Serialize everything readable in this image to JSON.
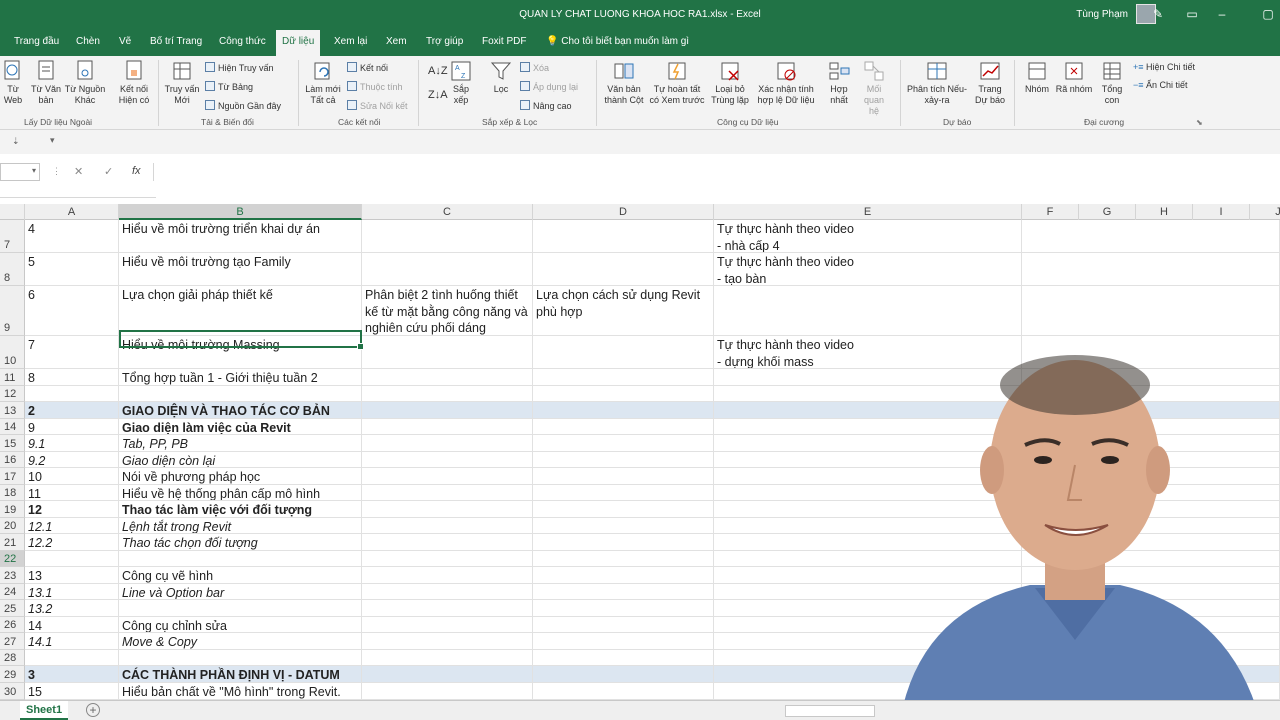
{
  "window": {
    "title": "QUAN LY CHAT LUONG KHOA HOC RA1.xlsx  -  Excel",
    "user": "Tùng Phạm"
  },
  "tabs": [
    "Trang đầu",
    "Chèn",
    "Vẽ",
    "Bố trí Trang",
    "Công thức",
    "Dữ liệu",
    "Xem lại",
    "Xem",
    "Trợ giúp",
    "Foxit PDF"
  ],
  "tell_me": "Cho tôi biết bạn muốn làm gì",
  "ribbon": {
    "get_external": {
      "label": "Lấy Dữ liệu Ngoài",
      "web": "Từ\nWeb",
      "text": "Từ Văn\nbản",
      "other": "Từ Nguồn\nKhác",
      "existing": "Kết nối\nHiện có"
    },
    "transform": {
      "label": "Tải & Biến đổi",
      "new_query": "Truy vấn\nMới",
      "show_queries": "Hiện Truy vấn",
      "from_table": "Từ Bảng",
      "recent_sources": "Nguồn Gần đây"
    },
    "connections": {
      "label": "Các kết nối",
      "refresh_all": "Làm mới\nTất cả",
      "connections": "Kết nối",
      "properties": "Thuộc tính",
      "edit_links": "Sửa Nối kết"
    },
    "sort_filter": {
      "label": "Sắp xếp & Lọc",
      "sort": "Sắp\nxếp",
      "filter": "Lọc",
      "clear": "Xóa",
      "reapply": "Áp dụng lại",
      "advanced": "Nâng cao"
    },
    "data_tools": {
      "label": "Công cụ Dữ liệu",
      "text_to_columns": "Văn bản\nthành Cột",
      "flash_fill": "Tự hoàn tất\ncó Xem trước",
      "remove_duplicates": "Loại bỏ\nTrùng lặp",
      "data_validation": "Xác nhận tính\nhợp lệ Dữ liệu",
      "consolidate": "Hợp\nnhất",
      "relationships": "Mối\nquan hệ"
    },
    "forecast": {
      "label": "Dự báo",
      "what_if": "Phân tích Nếu-\nxảy-ra",
      "forecast_sheet": "Trang\nDự báo"
    },
    "outline": {
      "label": "Đại cương",
      "group": "Nhóm",
      "ungroup": "Rã nhóm",
      "subtotal": "Tổng\ncon",
      "show_detail": "Hiện Chi tiết",
      "hide_detail": "Ẩn Chi tiết"
    }
  },
  "formula_bar": {
    "fx": "fx",
    "cancel": "✕",
    "enter": "✓"
  },
  "columns": [
    "A",
    "B",
    "C",
    "D",
    "E",
    "F",
    "G",
    "H",
    "I",
    "J"
  ],
  "selected_column": "B",
  "rows": [
    {
      "num": "7",
      "a": "4",
      "b": "Hiểu về môi trường triển khai dự án",
      "c": "",
      "d": "",
      "e": "Tự thực hành theo video\n- nhà cấp 4"
    },
    {
      "num": "8",
      "a": "5",
      "b": "Hiểu về môi trường tạo Family",
      "c": "",
      "d": "",
      "e": "Tự thực hành theo video\n- tạo bàn"
    },
    {
      "num": "9",
      "a": "6",
      "b": "Lựa chọn giải pháp thiết kế",
      "c": "Phân biệt 2 tình huống thiết kế từ mặt bằng công năng và nghiên cứu phối dáng",
      "d": "Lựa chọn cách sử dụng Revit phù hợp",
      "e": ""
    },
    {
      "num": "10",
      "a": "7",
      "b": "Hiểu về môi trường Massing",
      "c": "",
      "d": "",
      "e": "Tự thực hành theo video\n- dựng khối mass"
    },
    {
      "num": "11",
      "a": "8",
      "b": "Tổng hợp tuần 1 - Giới thiệu tuần 2",
      "c": "",
      "d": "",
      "e": ""
    },
    {
      "num": "12",
      "a": "",
      "b": "",
      "c": "",
      "d": "",
      "e": ""
    },
    {
      "num": "13",
      "a": "2",
      "b": "GIAO DIỆN VÀ THAO TÁC CƠ BẢN",
      "c": "",
      "d": "",
      "e": ""
    },
    {
      "num": "14",
      "a": "9",
      "b": "Giao diện làm việc của Revit",
      "c": "",
      "d": "",
      "e": ""
    },
    {
      "num": "15",
      "a": "9.1",
      "b": "Tab, PP, PB",
      "c": "",
      "d": "",
      "e": ""
    },
    {
      "num": "16",
      "a": "9.2",
      "b": "Giao diện còn lại",
      "c": "",
      "d": "",
      "e": ""
    },
    {
      "num": "17",
      "a": "10",
      "b": "Nói về phương pháp học",
      "c": "",
      "d": "",
      "e": ""
    },
    {
      "num": "18",
      "a": "11",
      "b": "Hiểu về hệ thống phân cấp mô hình",
      "c": "",
      "d": "",
      "e": ""
    },
    {
      "num": "19",
      "a": "12",
      "b": "Thao tác làm việc với đối tượng",
      "c": "",
      "d": "",
      "e": ""
    },
    {
      "num": "20",
      "a": "12.1",
      "b": "Lệnh tắt trong Revit",
      "c": "",
      "d": "",
      "e": ""
    },
    {
      "num": "21",
      "a": "12.2",
      "b": "Thao tác chọn đối tượng",
      "c": "",
      "d": "",
      "e": ""
    },
    {
      "num": "22",
      "a": "",
      "b": "",
      "c": "",
      "d": "",
      "e": ""
    },
    {
      "num": "23",
      "a": "13",
      "b": "Công cụ vẽ hình",
      "c": "",
      "d": "",
      "e": ""
    },
    {
      "num": "24",
      "a": "13.1",
      "b": "Line và Option bar",
      "c": "",
      "d": "",
      "e": ""
    },
    {
      "num": "25",
      "a": "13.2",
      "b": "",
      "c": "",
      "d": "",
      "e": ""
    },
    {
      "num": "26",
      "a": "14",
      "b": "Công cụ chỉnh sửa",
      "c": "",
      "d": "",
      "e": ""
    },
    {
      "num": "27",
      "a": "14.1",
      "b": "Move & Copy",
      "c": "",
      "d": "",
      "e": ""
    },
    {
      "num": "28",
      "a": "",
      "b": "",
      "c": "",
      "d": "",
      "e": ""
    },
    {
      "num": "29",
      "a": "3",
      "b": "CÁC THÀNH PHẦN ĐỊNH VỊ - DATUM",
      "c": "",
      "d": "",
      "e": ""
    },
    {
      "num": "30",
      "a": "15",
      "b": "Hiểu bản chất về \"Mô hình\" trong Revit.",
      "c": "",
      "d": "",
      "e": ""
    }
  ],
  "sheet_tab": "Sheet1",
  "colors": {
    "excel_green": "#217346",
    "section_band": "#dce6f1"
  }
}
